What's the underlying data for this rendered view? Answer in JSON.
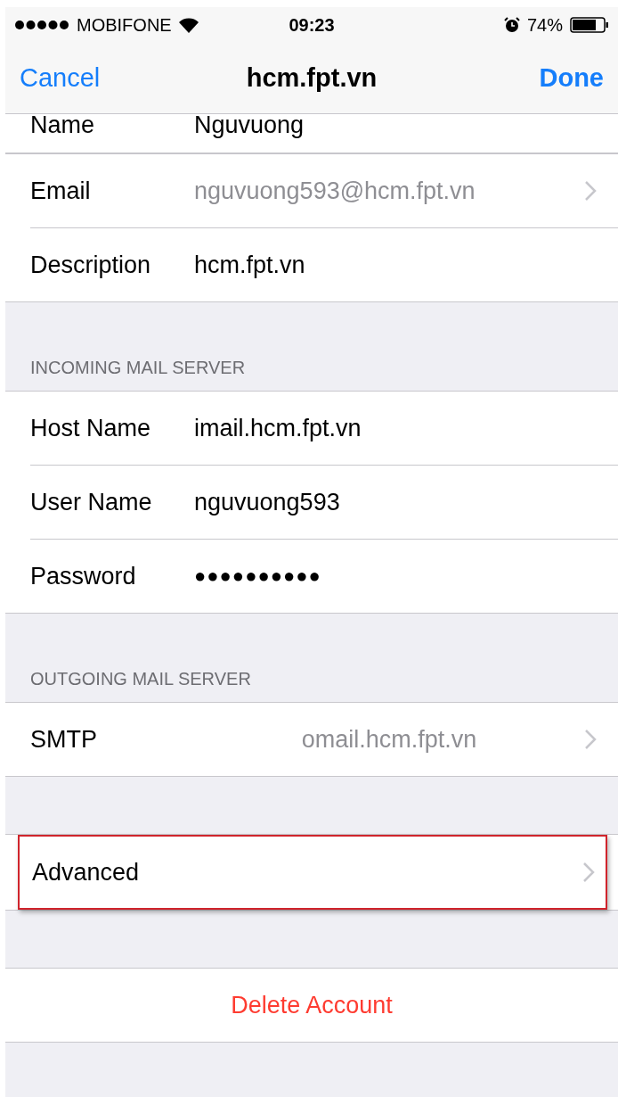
{
  "status_bar": {
    "carrier": "MOBIFONE",
    "time": "09:23",
    "battery": "74%"
  },
  "nav": {
    "cancel": "Cancel",
    "title": "hcm.fpt.vn",
    "done": "Done"
  },
  "sections": [
    {
      "cut": true,
      "rows": [
        {
          "kind": "field",
          "label": "Name",
          "value": "Nguvuong",
          "dimmed": false,
          "chevron": false
        }
      ]
    },
    {
      "rows": [
        {
          "kind": "field",
          "label": "Email",
          "value": "nguvuong593@hcm.fpt.vn",
          "dimmed": true,
          "chevron": true
        },
        {
          "kind": "field",
          "label": "Description",
          "value": "hcm.fpt.vn",
          "dimmed": false,
          "chevron": false
        }
      ]
    },
    {
      "header": "INCOMING MAIL SERVER",
      "rows": [
        {
          "kind": "field",
          "label": "Host Name",
          "value": "imail.hcm.fpt.vn",
          "dimmed": false,
          "chevron": false
        },
        {
          "kind": "field",
          "label": "User Name",
          "value": "nguvuong593",
          "dimmed": false,
          "chevron": false
        },
        {
          "kind": "password",
          "label": "Password",
          "value": "●●●●●●●●●●",
          "chevron": false
        }
      ]
    },
    {
      "header": "OUTGOING MAIL SERVER",
      "rows": [
        {
          "kind": "detail",
          "label": "SMTP",
          "value": "omail.hcm.fpt.vn",
          "dimmed": true,
          "chevron": true
        }
      ]
    },
    {
      "rows": [
        {
          "kind": "link",
          "label": "Advanced",
          "highlighted": true,
          "chevron": true
        }
      ]
    },
    {
      "rows": [
        {
          "kind": "action",
          "label": "Delete Account"
        }
      ]
    }
  ]
}
